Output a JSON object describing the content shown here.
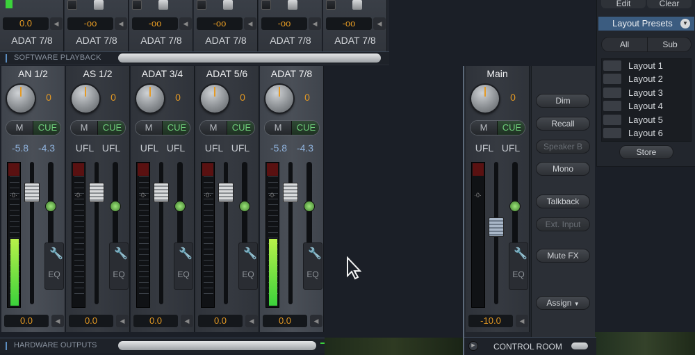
{
  "software_playback": {
    "label": "SOFTWARE PLAYBACK",
    "channels": [
      {
        "value": "0.0",
        "name": "ADAT 7/8"
      },
      {
        "value": "-oo",
        "name": "ADAT 7/8"
      },
      {
        "value": "-oo",
        "name": "ADAT 7/8"
      },
      {
        "value": "-oo",
        "name": "ADAT 7/8"
      },
      {
        "value": "-oo",
        "name": "ADAT 7/8"
      },
      {
        "value": "-oo",
        "name": "ADAT 7/8"
      }
    ]
  },
  "hardware_outputs": {
    "label": "HARDWARE OUTPUTS",
    "channels": [
      {
        "name": "AN 1/2",
        "gain": "0",
        "mute": "M",
        "cue": "CUE",
        "level_l": "-5.8",
        "level_r": "-4.3",
        "meter_level": 0.48,
        "eq": "EQ",
        "output": "0.0"
      },
      {
        "name": "AS 1/2",
        "gain": "0",
        "mute": "M",
        "cue": "CUE",
        "level_l": "UFL",
        "level_r": "UFL",
        "meter_level": 0,
        "eq": "EQ",
        "output": "0.0"
      },
      {
        "name": "ADAT 3/4",
        "gain": "0",
        "mute": "M",
        "cue": "CUE",
        "level_l": "UFL",
        "level_r": "UFL",
        "meter_level": 0,
        "eq": "EQ",
        "output": "0.0"
      },
      {
        "name": "ADAT 5/6",
        "gain": "0",
        "mute": "M",
        "cue": "CUE",
        "level_l": "UFL",
        "level_r": "UFL",
        "meter_level": 0,
        "eq": "EQ",
        "output": "0.0"
      },
      {
        "name": "ADAT 7/8",
        "gain": "0",
        "mute": "M",
        "cue": "CUE",
        "level_l": "-5.8",
        "level_r": "-4.3",
        "meter_level": 0.48,
        "eq": "EQ",
        "output": "0.0"
      }
    ]
  },
  "control_room": {
    "label": "CONTROL ROOM",
    "main": {
      "name": "Main",
      "gain": "0",
      "mute": "M",
      "cue": "CUE",
      "level_l": "UFL",
      "level_r": "UFL",
      "eq": "EQ",
      "output": "-10.0"
    },
    "buttons": [
      {
        "label": "Dim",
        "enabled": true
      },
      {
        "label": "Recall",
        "enabled": true
      },
      {
        "label": "Speaker B",
        "enabled": false
      },
      {
        "label": "Mono",
        "enabled": true
      },
      {
        "label": "Talkback",
        "enabled": true
      },
      {
        "label": "Ext. Input",
        "enabled": false
      },
      {
        "label": "Mute FX",
        "enabled": true
      },
      {
        "label": "Assign",
        "enabled": true
      }
    ]
  },
  "layout_panel": {
    "edit": "Edit",
    "clear": "Clear",
    "title": "Layout Presets",
    "tabs": [
      "All",
      "Sub"
    ],
    "presets": [
      "Layout 1",
      "Layout 2",
      "Layout 3",
      "Layout 4",
      "Layout 5",
      "Layout 6"
    ],
    "store": "Store"
  },
  "colors": {
    "accent_orange": "#e59a23",
    "cue_green": "#6fd07a",
    "meter_green": "#3bd23b",
    "preset_highlight": "#3b5c80"
  }
}
